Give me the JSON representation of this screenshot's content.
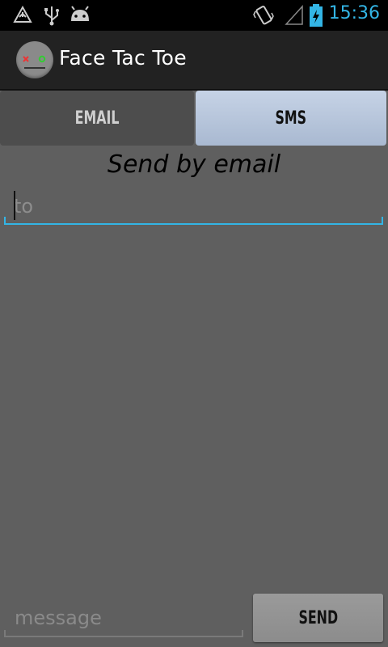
{
  "status_bar": {
    "time": "15:36",
    "icons": [
      "warning-icon",
      "usb-icon",
      "android-debug-icon",
      "vibrate-icon",
      "signal-icon",
      "battery-charging-icon"
    ],
    "accent_color": "#33b5e5"
  },
  "action_bar": {
    "title": "Face Tac Toe",
    "icon": "app-face-icon"
  },
  "tabs": [
    {
      "label": "EMAIL",
      "selected": false
    },
    {
      "label": "SMS",
      "selected": true
    }
  ],
  "main": {
    "heading": "Send by email",
    "to_field": {
      "value": "",
      "placeholder": "to"
    },
    "message_field": {
      "value": "",
      "placeholder": "message"
    },
    "send_label": "SEND"
  }
}
